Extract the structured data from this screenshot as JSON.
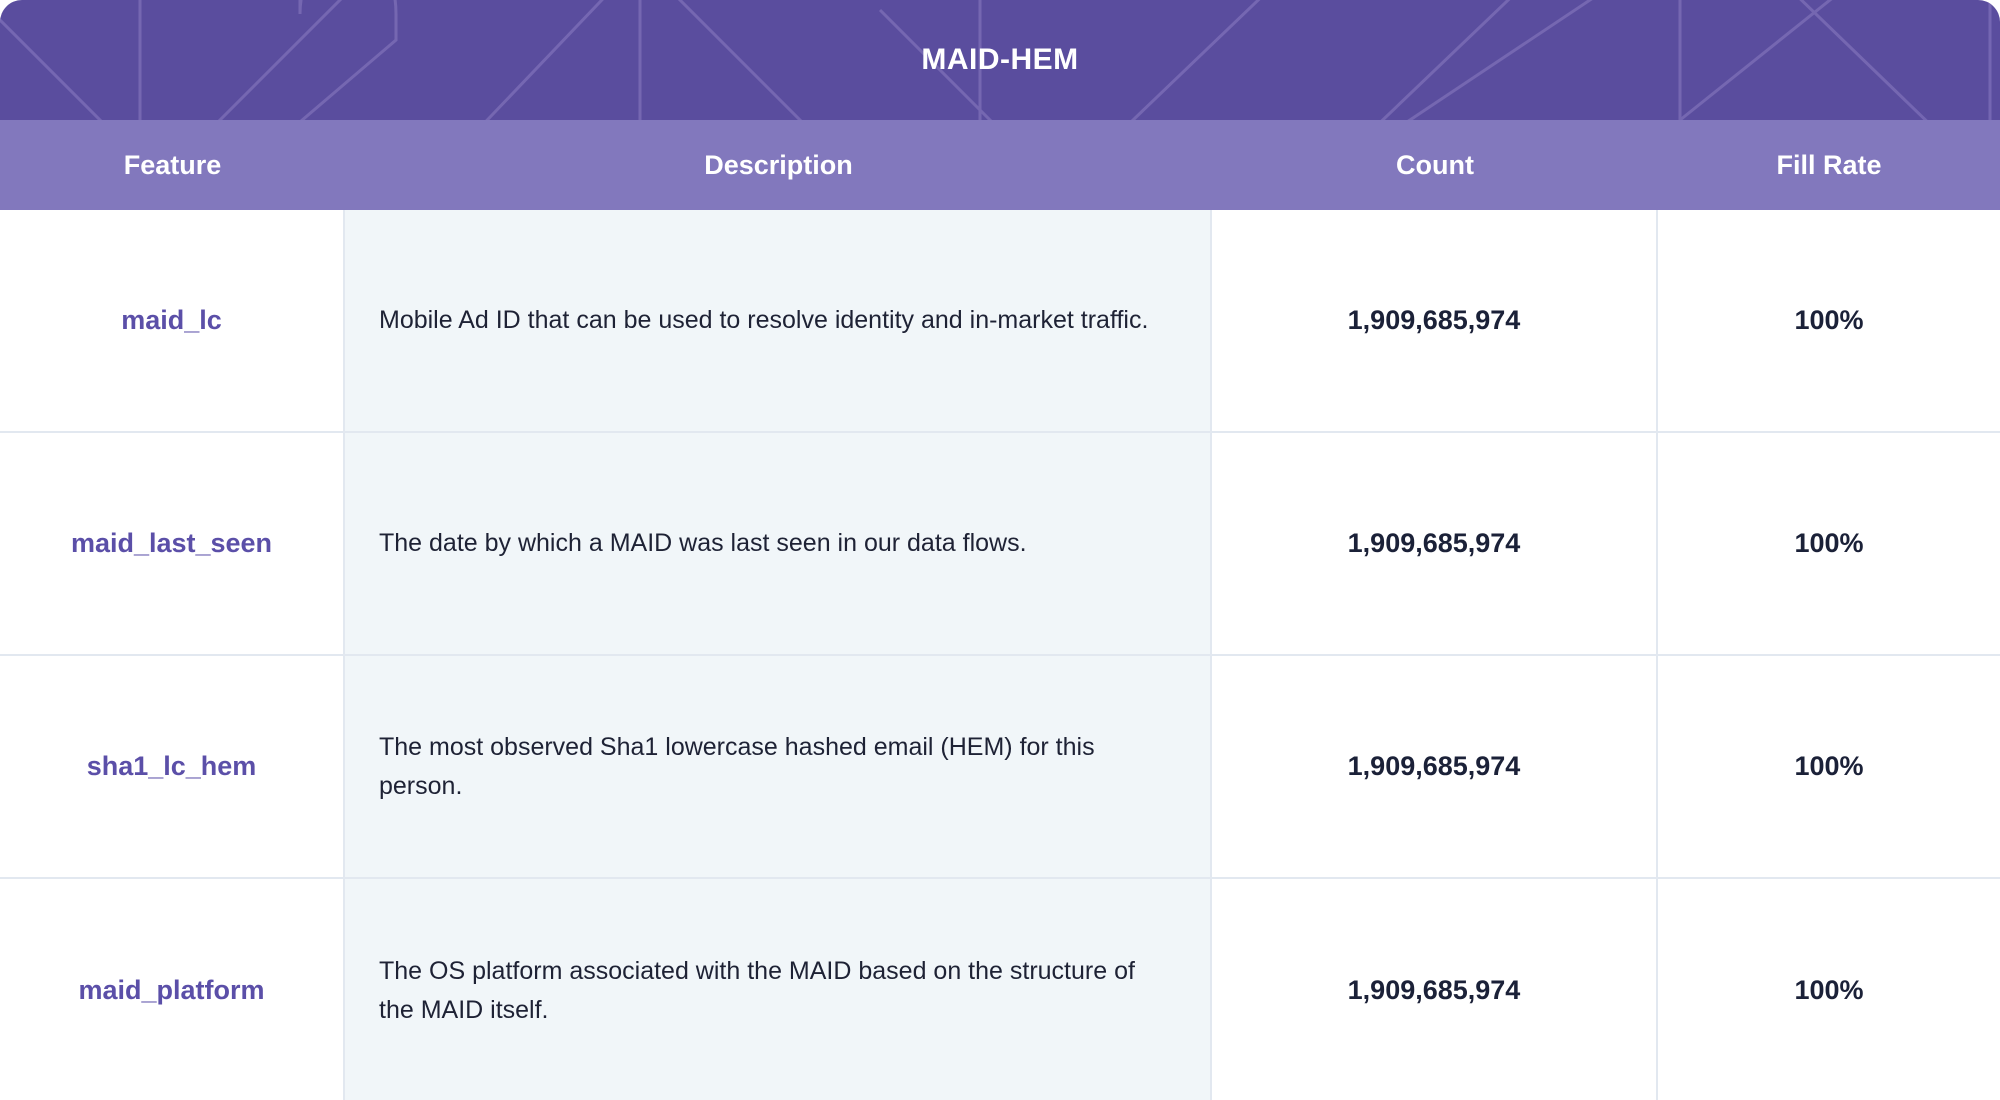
{
  "banner": {
    "title": "MAID-HEM",
    "bg_color": "#5a4d9e",
    "title_color": "#ffffff"
  },
  "table": {
    "header_bg": "#8278bd",
    "header_text_color": "#ffffff",
    "feature_color": "#5b4fa8",
    "description_bg": "#f1f6f9",
    "border_color": "#e2e8f0",
    "columns": [
      {
        "key": "feature",
        "label": "Feature"
      },
      {
        "key": "description",
        "label": "Description"
      },
      {
        "key": "count",
        "label": "Count"
      },
      {
        "key": "fill_rate",
        "label": "Fill Rate"
      }
    ],
    "rows": [
      {
        "feature": "maid_lc",
        "description": "Mobile Ad ID that can be used to resolve identity and in-market traffic.",
        "count": "1,909,685,974",
        "fill_rate": "100%"
      },
      {
        "feature": "maid_last_seen",
        "description": "The date by which a MAID was last seen in our data flows.",
        "count": "1,909,685,974",
        "fill_rate": "100%"
      },
      {
        "feature": "sha1_lc_hem",
        "description": "The most observed Sha1 lowercase hashed email (HEM) for this person.",
        "count": "1,909,685,974",
        "fill_rate": "100%"
      },
      {
        "feature": "maid_platform",
        "description": "The OS platform associated with the MAID based on the structure of the MAID itself.",
        "count": "1,909,685,974",
        "fill_rate": "100%"
      }
    ]
  }
}
